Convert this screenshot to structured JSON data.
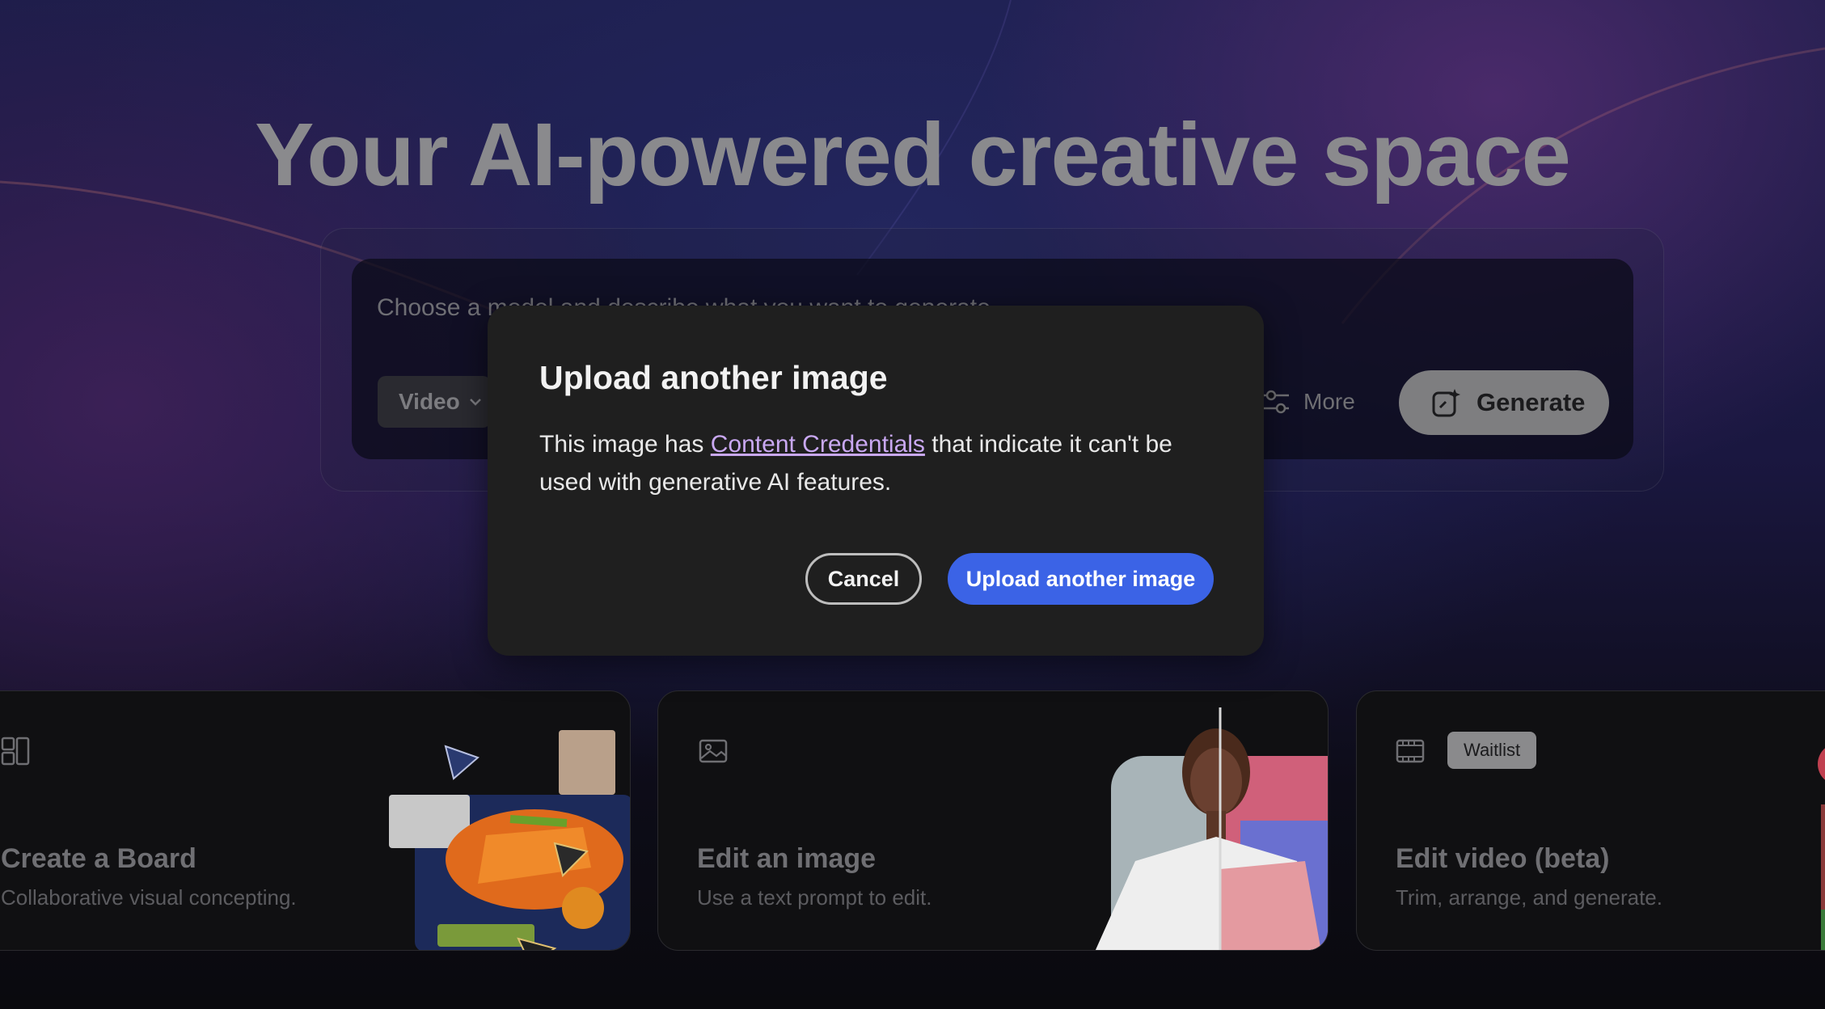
{
  "hero": {
    "title": "Your AI-powered creative space"
  },
  "prompt": {
    "placeholder": "Choose a model and describe what you want to generate",
    "model_select": "Video",
    "more_label": "More",
    "generate_label": "Generate"
  },
  "cards": [
    {
      "title": "Create a Board",
      "subtitle": "Collaborative visual concepting.",
      "icon": "board-icon"
    },
    {
      "title": "Edit an image",
      "subtitle": "Use a text prompt to edit.",
      "icon": "image-icon"
    },
    {
      "title": "Edit video (beta)",
      "subtitle": "Trim, arrange, and generate.",
      "icon": "film-icon",
      "badge": "Waitlist"
    }
  ],
  "dialog": {
    "title": "Upload another image",
    "body_before": "This image has ",
    "link": "Content Credentials",
    "body_after": " that indicate it can't be used with generative AI features.",
    "cancel_label": "Cancel",
    "confirm_label": "Upload another image"
  },
  "colors": {
    "primary_button": "#3b63e6",
    "link": "#c9a8f2",
    "dialog_bg": "#1f1f1f"
  }
}
